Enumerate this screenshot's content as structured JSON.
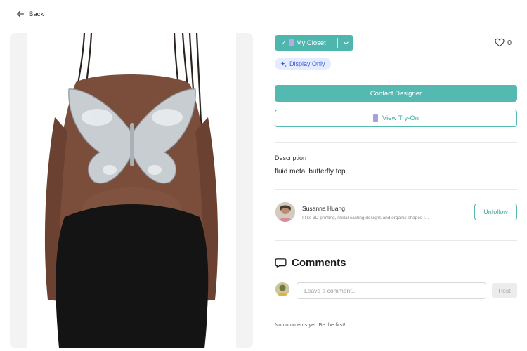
{
  "nav": {
    "back_label": "Back"
  },
  "product": {
    "closet_label": "My Closet",
    "like_count": "0",
    "display_badge": "Display Only",
    "contact_label": "Contact Designer",
    "tryon_label": "View Try-On",
    "description_label": "Description",
    "description_text": "fluid metal butterfly top",
    "photo_alt": "fluid metal butterfly top"
  },
  "designer": {
    "name": "Susanna Huang",
    "bio": "I like 3D printing, metal casting designs and organic shapes :...",
    "unfollow_label": "Unfollow"
  },
  "comments": {
    "title": "Comments",
    "placeholder": "Leave a comment...",
    "post_label": "Post",
    "empty_text": "No comments yet. Be the first!"
  },
  "colors": {
    "accent": "#54b9b0",
    "badge_bg": "#e5ecff",
    "badge_text": "#3b5bdb"
  },
  "icons": [
    "arrow-left-icon",
    "check-icon",
    "hanger-icon",
    "chevron-down-icon",
    "heart-icon",
    "sparkle-icon",
    "comment-icon"
  ]
}
